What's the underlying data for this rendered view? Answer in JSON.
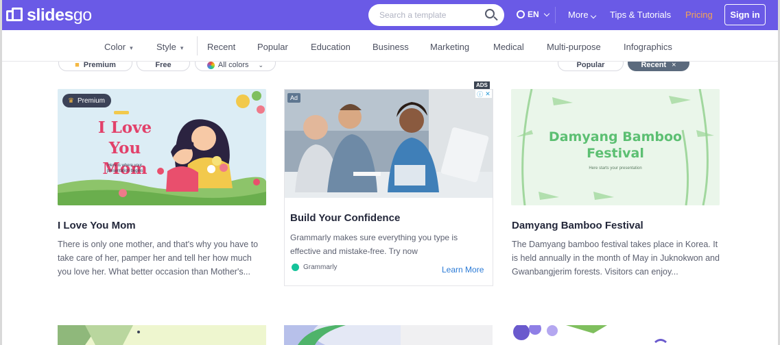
{
  "header": {
    "logo_text": "slides",
    "logo_text_suffix": "go",
    "search_placeholder": "Search a template",
    "lang": "EN",
    "more": "More",
    "tips": "Tips & Tutorials",
    "pricing": "Pricing",
    "signin": "Sign in"
  },
  "nav": {
    "color": "Color",
    "style": "Style",
    "links": [
      "Recent",
      "Popular",
      "Education",
      "Business",
      "Marketing",
      "Medical",
      "Multi-purpose",
      "Infographics"
    ]
  },
  "filters": {
    "premium": "Premium",
    "free": "Free",
    "colors": "All colors",
    "popular": "Popular",
    "recent": "Recent"
  },
  "cards": [
    {
      "badge": "Premium",
      "thumb_title_line1": "I Love",
      "thumb_title_line2": "You Mom",
      "thumb_sub1": "Here is where your",
      "thumb_sub2": "presentation begins",
      "title": "I Love You Mom",
      "desc": "There is only one mother, and that's why you have to take care of her, pamper her and tell her how much you love her. What better occasion than Mother's..."
    },
    {
      "ads_label": "ADS",
      "ad_tag": "Ad",
      "title": "Build Your Confidence",
      "desc": "Grammarly makes sure everything you type is effective and mistake-free. Try now",
      "brand": "Grammarly",
      "cta": "Learn More"
    },
    {
      "thumb_title_line1": "Damyang Bamboo",
      "thumb_title_line2": "Festival",
      "thumb_sub": "Here starts your presentation",
      "title": "Damyang Bamboo Festival",
      "desc": "The Damyang bamboo festival takes place in Korea. It is held annually in the month of May in Juknokwon and Gwanbangjerim forests. Visitors can enjoy..."
    }
  ],
  "colors": {
    "brand": "#6a5ae6",
    "pricing": "#f7a552",
    "link": "#2a7ad6"
  }
}
